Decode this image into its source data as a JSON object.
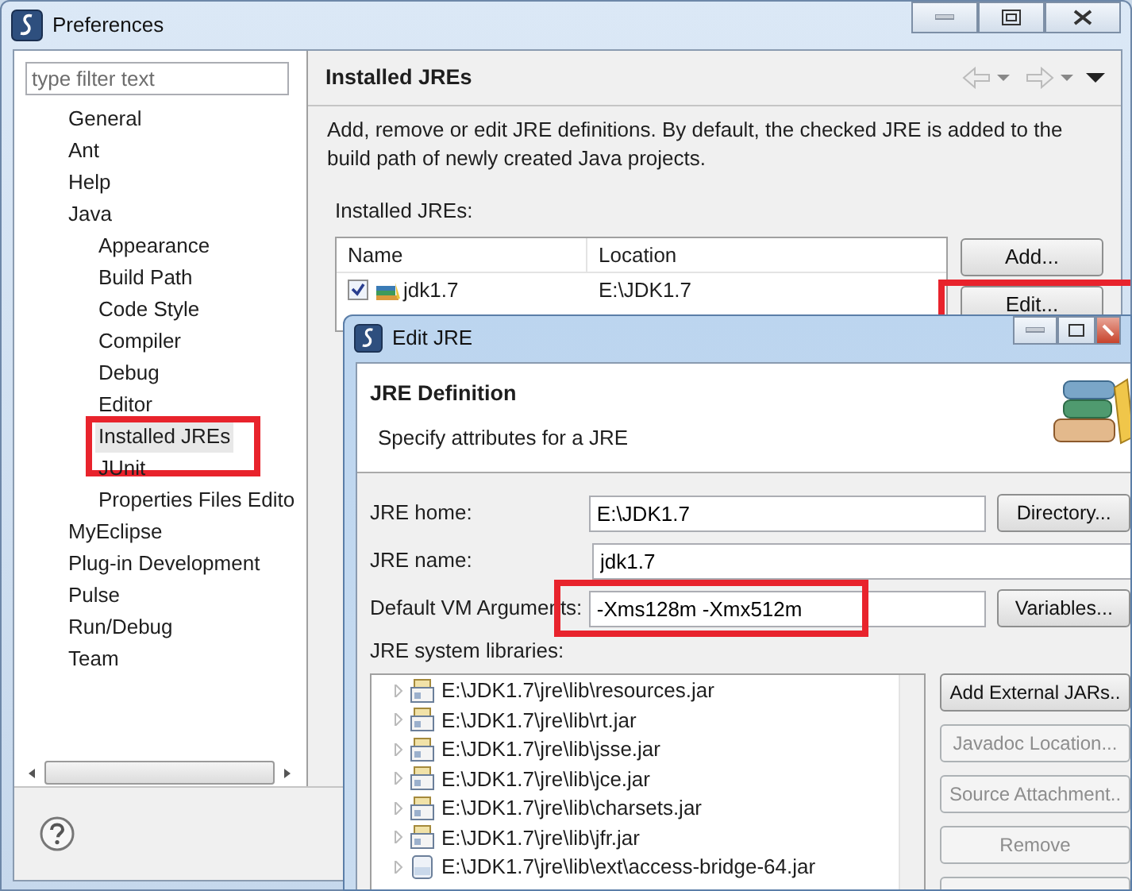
{
  "window": {
    "title": "Preferences"
  },
  "filter": {
    "placeholder": "type filter text"
  },
  "tree": [
    {
      "label": "General",
      "selected": false,
      "highlighted": false
    },
    {
      "label": "Ant",
      "selected": false,
      "highlighted": false
    },
    {
      "label": "Help",
      "selected": false,
      "highlighted": false
    },
    {
      "label": "Java",
      "selected": false,
      "highlighted": false,
      "children": [
        {
          "label": "Appearance",
          "selected": false,
          "highlighted": false
        },
        {
          "label": "Build Path",
          "selected": false,
          "highlighted": false
        },
        {
          "label": "Code Style",
          "selected": false,
          "highlighted": false
        },
        {
          "label": "Compiler",
          "selected": false,
          "highlighted": false
        },
        {
          "label": "Debug",
          "selected": false,
          "highlighted": false
        },
        {
          "label": "Editor",
          "selected": false,
          "highlighted": false
        },
        {
          "label": "Installed JREs",
          "selected": true,
          "highlighted": true
        },
        {
          "label": "JUnit",
          "selected": false
        },
        {
          "label": "Properties Files Edito",
          "selected": false,
          "highlighted": false
        }
      ]
    },
    {
      "label": "MyEclipse",
      "selected": false,
      "highlighted": false
    },
    {
      "label": "Plug-in Development",
      "selected": false,
      "highlighted": false
    },
    {
      "label": "Pulse",
      "selected": false,
      "highlighted": false
    },
    {
      "label": "Run/Debug",
      "selected": false,
      "highlighted": false
    },
    {
      "label": "Team",
      "selected": false,
      "highlighted": false
    }
  ],
  "page": {
    "title": "Installed JREs",
    "description": "Add, remove or edit JRE definitions. By default, the checked JRE is added to the build path of newly created Java projects.",
    "list_label": "Installed JREs:",
    "columns": [
      "Name",
      "Location"
    ],
    "rows": [
      {
        "name": "jdk1.7",
        "location": "E:\\JDK1.7",
        "checked": true
      }
    ],
    "buttons": [
      {
        "label": "Add...",
        "highlighted": false
      },
      {
        "label": "Edit...",
        "highlighted": true
      }
    ]
  },
  "dialog": {
    "title": "Edit JRE",
    "heading": "JRE Definition",
    "subtitle": "Specify attributes for a JRE",
    "fields": [
      {
        "label": "JRE home:",
        "value": "E:\\JDK1.7",
        "button": "Directory...",
        "highlighted": false
      },
      {
        "label": "JRE name:",
        "value": "jdk1.7",
        "highlighted": false
      },
      {
        "label": "Default VM Arguments:",
        "value": "-Xms128m -Xmx512m",
        "button": "Variables...",
        "highlighted": true
      }
    ],
    "libraries_label": "JRE system libraries:",
    "libraries": [
      {
        "path": "E:\\JDK1.7\\jre\\lib\\resources.jar",
        "kind": "jar"
      },
      {
        "path": "E:\\JDK1.7\\jre\\lib\\rt.jar",
        "kind": "jar"
      },
      {
        "path": "E:\\JDK1.7\\jre\\lib\\jsse.jar",
        "kind": "jar"
      },
      {
        "path": "E:\\JDK1.7\\jre\\lib\\jce.jar",
        "kind": "jar"
      },
      {
        "path": "E:\\JDK1.7\\jre\\lib\\charsets.jar",
        "kind": "jar"
      },
      {
        "path": "E:\\JDK1.7\\jre\\lib\\jfr.jar",
        "kind": "jar"
      },
      {
        "path": "E:\\JDK1.7\\jre\\lib\\ext\\access-bridge-64.jar",
        "kind": "binary"
      }
    ],
    "buttons": [
      {
        "label": "Add External JARs..",
        "disabled": false
      },
      {
        "label": "Javadoc Location...",
        "disabled": true
      },
      {
        "label": "Source Attachment..",
        "disabled": true
      },
      {
        "label": "Remove",
        "disabled": true
      }
    ]
  }
}
